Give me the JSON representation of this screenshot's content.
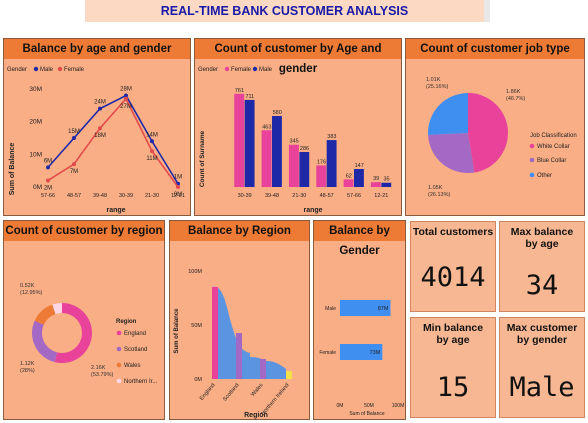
{
  "dashboard": {
    "title": "REAL-TIME BANK CUSTOMER ANALYSIS"
  },
  "colors": {
    "blue": "#1f29a8",
    "pink": "#e8429a",
    "mid_blue": "#3f8ff0",
    "orange": "#ee7b35",
    "purple": "#a469c4",
    "red": "#e34a4a"
  },
  "panels": {
    "balance_age_gender": {
      "title": "Balance by age and gender",
      "legend_label": "Gender",
      "legend_items": [
        "Male",
        "Female"
      ],
      "xlabel": "range",
      "ylabel": "Sum of Balance"
    },
    "count_age_gender": {
      "title": "Count of customer by Age and gender",
      "legend_label": "Gender",
      "legend_items": [
        "Female",
        "Male"
      ],
      "xlabel": "range",
      "ylabel": "Count of Surname"
    },
    "job_type": {
      "title": "Count of customer job type",
      "legend_title": "Job Classification",
      "legend_items": [
        "White Collar",
        "Blue Collar",
        "Other"
      ]
    },
    "region_count": {
      "title": "Count of customer by region",
      "legend_title": "Region",
      "legend_items": [
        "England",
        "Scotland",
        "Wales",
        "Northern Ir..."
      ]
    },
    "balance_region": {
      "title": "Balance by Region",
      "xlabel": "Region",
      "ylabel": "Sum of Balance"
    },
    "balance_gender": {
      "title": "Balance by Gender",
      "xlabel": "Sum of Balance"
    }
  },
  "kpis": {
    "total_customers": {
      "label": "Total customers",
      "value": "4014"
    },
    "max_balance_age": {
      "label": "Max balance by age",
      "value": "34"
    },
    "min_balance_age": {
      "label": "Min balance by age",
      "value": "15"
    },
    "max_customer_gender": {
      "label": "Max customer by gender",
      "value": "Male"
    }
  },
  "chart_data": [
    {
      "type": "line",
      "title": "Balance by age and gender",
      "categories": [
        "57-66",
        "48-57",
        "39-48",
        "30-39",
        "21-30",
        "12-21"
      ],
      "series": [
        {
          "name": "Male",
          "values": [
            6,
            15,
            24,
            28,
            14,
            1
          ],
          "labels": [
            "6M",
            "15M",
            "24M",
            "28M",
            "14M",
            "1M"
          ]
        },
        {
          "name": "Female",
          "values": [
            2,
            7,
            18,
            27,
            11,
            0
          ],
          "labels": [
            "2M",
            "7M",
            "18M",
            "27M",
            "11M",
            "0M"
          ]
        }
      ],
      "yticks": [
        "0M",
        "10M",
        "20M",
        "30M"
      ],
      "ylim": [
        0,
        30
      ],
      "xlabel": "range",
      "ylabel": "Sum of Balance"
    },
    {
      "type": "bar",
      "title": "Count of customer by Age and gender",
      "categories": [
        "30-39",
        "39-48",
        "21-30",
        "48-57",
        "57-66",
        "12-21"
      ],
      "series": [
        {
          "name": "Female",
          "values": [
            761,
            463,
            345,
            176,
            62,
            39
          ]
        },
        {
          "name": "Male",
          "values": [
            711,
            580,
            286,
            383,
            147,
            35
          ]
        }
      ],
      "ylim": [
        0,
        800
      ],
      "xlabel": "range",
      "ylabel": "Count of Surname"
    },
    {
      "type": "pie",
      "title": "Count of customer job type",
      "slices": [
        {
          "name": "White Collar",
          "value": 1.86,
          "label": "1.86K",
          "pct": "(46.7%)"
        },
        {
          "name": "Blue Collar",
          "value": 1.05,
          "label": "1.05K",
          "pct": "(26.13%)"
        },
        {
          "name": "Other",
          "value": 1.01,
          "label": "1.01K",
          "pct": "(25.16%)"
        }
      ]
    },
    {
      "type": "pie",
      "title": "Count of customer by region",
      "slices": [
        {
          "name": "England",
          "value": 2.16,
          "label": "2.16K",
          "pct": "(53.79%)"
        },
        {
          "name": "Scotland",
          "value": 1.12,
          "label": "1.12K",
          "pct": "(28%)"
        },
        {
          "name": "Wales",
          "value": 0.52,
          "label": "0.52K",
          "pct": "(12.95%)"
        },
        {
          "name": "Northern Ir...",
          "value": 0.21,
          "label": "",
          "pct": ""
        }
      ]
    },
    {
      "type": "area",
      "title": "Balance by Region",
      "categories": [
        "England",
        "Scotland",
        "Wales",
        "Northern Ireland"
      ],
      "yticks": [
        "0M",
        "50M",
        "100M"
      ],
      "ylim": [
        0,
        100
      ],
      "xlabel": "Region",
      "ylabel": "Sum of Balance"
    },
    {
      "type": "bar",
      "title": "Balance by Gender",
      "categories": [
        "Male",
        "Female"
      ],
      "values": [
        87,
        73
      ],
      "labels": [
        "87M",
        "73M"
      ],
      "xticks": [
        "0M",
        "50M",
        "100M"
      ],
      "xlim": [
        0,
        100
      ],
      "xlabel": "Sum of Balance"
    }
  ]
}
